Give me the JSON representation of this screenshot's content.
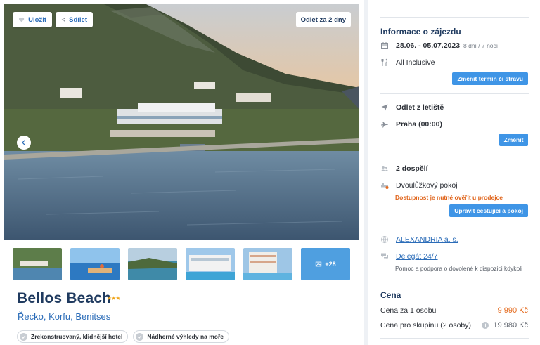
{
  "gallery": {
    "save_label": "Uložit",
    "share_label": "Sdílet",
    "departure_badge": "Odlet za 2 dny",
    "more_photos_label": "+28"
  },
  "hotel": {
    "name": "Bellos Beach",
    "stars": "★★★",
    "location": "Řecko, Korfu, Benitses",
    "tags": [
      "Zrekonstruovaný, klidnější hotel",
      "Nádherné výhledy na moře"
    ]
  },
  "trip_info": {
    "title": "Informace o zájezdu",
    "dates": "28.06. - 05.07.2023",
    "duration": "8 dní / 7 nocí",
    "board": "All Inclusive",
    "change_term_button": "Změnit termín či stravu"
  },
  "flight": {
    "label": "Odlet z letiště",
    "airport": "Praha (00:00)",
    "change_button": "Změnit"
  },
  "travellers": {
    "count": "2 dospělí",
    "room": "Dvoulůžkový pokoj",
    "availability_note": "Dostupnost je nutné ověřit u prodejce",
    "edit_button": "Upravit cestující a pokoj"
  },
  "agency": {
    "name": "ALEXANDRIA a. s.",
    "delegate": "Delegát 24/7",
    "delegate_note": "Pomoc a podpora o dovolené k dispozici kdykoli"
  },
  "price": {
    "title": "Cena",
    "per_person_label": "Cena za 1 osobu",
    "per_person_value": "9 990 Kč",
    "group_label": "Cena pro skupinu (2 osoby)",
    "group_value": "19 980 Kč"
  },
  "colors": {
    "brand_navy": "#1f3a5f",
    "accent_blue": "#3f95e6",
    "price_orange": "#e46a1d",
    "star_gold": "#f0a51a"
  }
}
